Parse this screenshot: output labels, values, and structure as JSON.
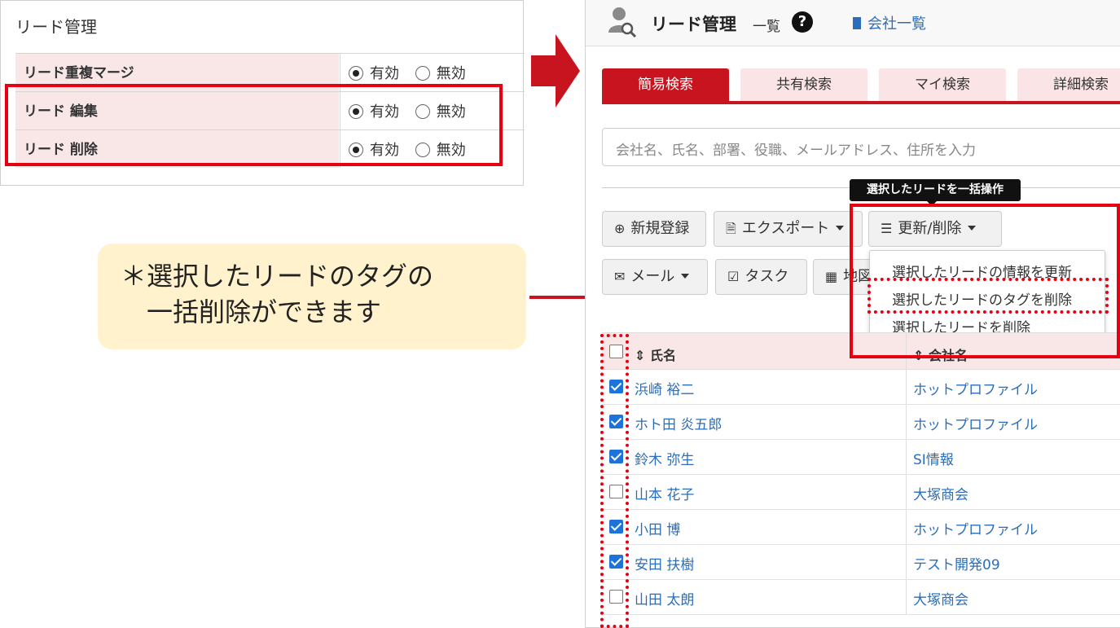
{
  "settings": {
    "title": "リード管理",
    "rows": [
      {
        "label": "リード重複マージ",
        "options": [
          "有効",
          "無効"
        ],
        "selected": "有効"
      },
      {
        "label": "リード 編集",
        "options": [
          "有効",
          "無効"
        ],
        "selected": "有効"
      },
      {
        "label": "リード 削除",
        "options": [
          "有効",
          "無効"
        ],
        "selected": "有効"
      }
    ]
  },
  "callout": {
    "line1": "＊選択したリードのタグの",
    "line2": "一括削除ができます"
  },
  "app": {
    "title": "リード管理",
    "subtitle": "一覧",
    "company_link": "会社一覧",
    "tabs": [
      {
        "label": "簡易検索",
        "active": true
      },
      {
        "label": "共有検索",
        "active": false
      },
      {
        "label": "マイ検索",
        "active": false
      },
      {
        "label": "詳細検索",
        "active": false
      }
    ],
    "search_placeholder": "会社名、氏名、部署、役職、メールアドレス、住所を入力",
    "toolbar": {
      "new_label": "新規登録",
      "export_label": "エクスポート",
      "update_delete_label": "更新/削除",
      "mail_label": "メール",
      "task_label": "タスク",
      "map_label": "地図"
    },
    "tooltip": "選択したリードを一括操作",
    "menu": [
      "選択したリードの情報を更新",
      "選択したリードのタグを削除",
      "選択したリードを削除"
    ],
    "table": {
      "col_name": "氏名",
      "col_company": "会社名",
      "rows": [
        {
          "name": "浜崎 裕二",
          "company": "ホットプロファイル",
          "checked": true
        },
        {
          "name": "ホト田 炎五郎",
          "company": "ホットプロファイル",
          "checked": true
        },
        {
          "name": "鈴木 弥生",
          "company": "SI情報",
          "checked": true
        },
        {
          "name": "山本 花子",
          "company": "大塚商会",
          "checked": false
        },
        {
          "name": "小田 博",
          "company": "ホットプロファイル",
          "checked": true
        },
        {
          "name": "安田 扶樹",
          "company": "テスト開発09",
          "checked": true
        },
        {
          "name": "山田 太朗",
          "company": "大塚商会",
          "checked": false
        }
      ]
    }
  },
  "colors": {
    "accent": "#c8141e",
    "annotation": "#e60012",
    "link": "#2a6ebb",
    "callout_bg": "#fff2cc"
  }
}
